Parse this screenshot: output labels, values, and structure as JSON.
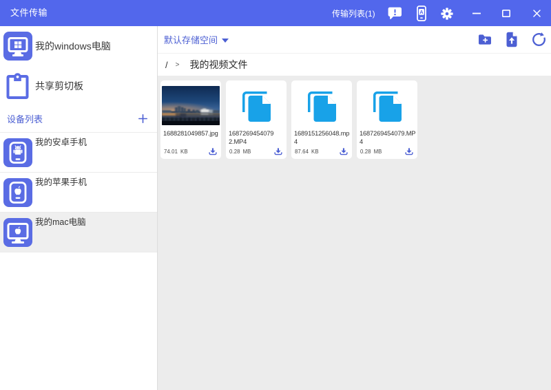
{
  "colors": {
    "titlebar": "#5267ec",
    "icon_blue": "#5a6ce4",
    "action": "#4c5fd3",
    "file_icon_blue": "#18a2e8",
    "contentbg": "#ececec",
    "selected": "#efefef"
  },
  "titlebar": {
    "title": "文件传输",
    "transfer_list_label": "传输列表(1)"
  },
  "sidebar": {
    "computer": {
      "label": "我的windows电脑"
    },
    "clipboard": {
      "label": "共享剪切板"
    },
    "device_list_header": "设备列表",
    "devices": [
      {
        "label": "我的安卓手机",
        "type": "android",
        "selected": false
      },
      {
        "label": "我的苹果手机",
        "type": "iphone",
        "selected": false
      },
      {
        "label": "我的mac电脑",
        "type": "mac",
        "selected": true
      }
    ]
  },
  "toolbar": {
    "storage_selector_label": "默认存储空间"
  },
  "breadcrumb": {
    "root": "/",
    "separator": ">",
    "current_folder": "我的视频文件"
  },
  "files": [
    {
      "name": "1688281049857.jpg",
      "name_lines": [
        "1688281049857.jpg"
      ],
      "size_value": "74.01",
      "size_unit": "KB",
      "kind": "image"
    },
    {
      "name": "1687269454079 2.MP4",
      "name_lines": [
        "1687269454079",
        "2.MP4"
      ],
      "size_value": "0.28",
      "size_unit": "MB",
      "kind": "video"
    },
    {
      "name": "1689151256048.mp4",
      "name_lines": [
        "1689151256048.mp",
        "4"
      ],
      "size_value": "87.64",
      "size_unit": "KB",
      "kind": "video"
    },
    {
      "name": "1687269454079.MP4",
      "name_lines": [
        "1687269454079.MP",
        "4"
      ],
      "size_value": "0.28",
      "size_unit": "MB",
      "kind": "video"
    }
  ]
}
